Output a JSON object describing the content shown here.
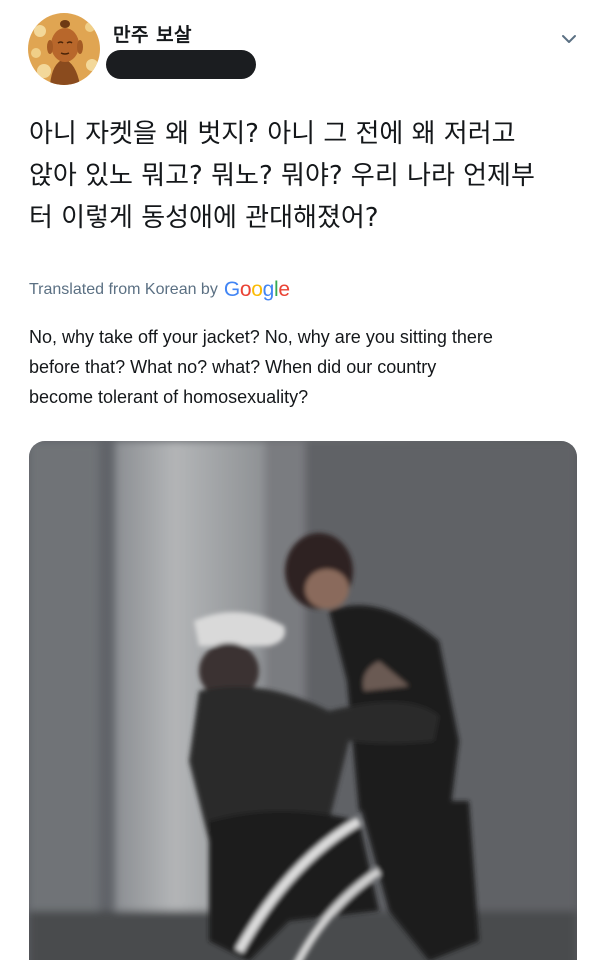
{
  "user": {
    "display_name": "만주 보살",
    "handle": "",
    "avatar_icon": "buddha-avatar-icon"
  },
  "header": {
    "more_icon": "chevron-down-icon"
  },
  "tweet": {
    "text_lines": [
      "아니 자켓을 왜 벗지? 아니 그 전에 왜 저러고",
      "앉아 있노 뭐고? 뭐노? 뭐야? 우리 나라 언제부",
      "터 이렇게 동성애에 관대해졌어?"
    ]
  },
  "translation": {
    "label": "Translated from Korean by",
    "provider": "Google",
    "lines": [
      "No, why take off your jacket? No, why are you sitting there",
      "before that? What no? what? When did our country",
      "become tolerant of homosexuality?"
    ]
  },
  "media": {
    "type": "photo",
    "description_icon": "photo-media"
  },
  "colors": {
    "text": "#14171a",
    "secondary": "#5b7083",
    "google_blue": "#4285f4",
    "google_red": "#ea4335",
    "google_yellow": "#fbbc05",
    "google_green": "#34a853"
  }
}
